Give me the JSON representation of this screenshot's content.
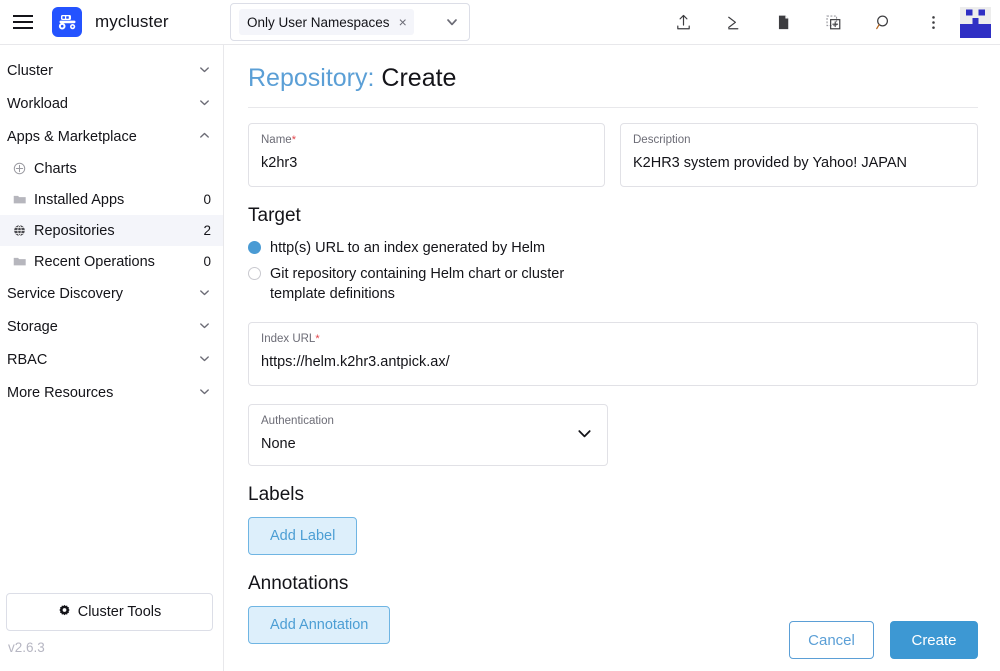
{
  "topbar": {
    "menu_icon": "hamburger-icon",
    "logo_icon": "rancher-logo-icon",
    "cluster_name": "mycluster",
    "namespace_filter": {
      "chip_label": "Only User Namespaces",
      "chip_remove": "×",
      "caret": "⌄"
    },
    "icons": [
      {
        "name": "import-yaml-icon",
        "glyph": "upload"
      },
      {
        "name": "kubectl-shell-icon",
        "glyph": "terminal"
      },
      {
        "name": "kubeconfig-download-icon",
        "glyph": "file"
      },
      {
        "name": "copy-kubeconfig-icon",
        "glyph": "copy"
      },
      {
        "name": "search-icon",
        "glyph": "search"
      },
      {
        "name": "overflow-menu-icon",
        "glyph": "kebab"
      }
    ],
    "avatar": "user-avatar"
  },
  "sidebar": {
    "groups": [
      {
        "label": "Cluster",
        "expanded": false
      },
      {
        "label": "Workload",
        "expanded": false
      },
      {
        "label": "Apps & Marketplace",
        "expanded": true
      }
    ],
    "items": [
      {
        "label": "Charts",
        "icon": "compass-icon",
        "count": "",
        "active": false
      },
      {
        "label": "Installed Apps",
        "icon": "folder-icon",
        "count": "0",
        "active": false
      },
      {
        "label": "Repositories",
        "icon": "globe-icon",
        "count": "2",
        "active": true
      },
      {
        "label": "Recent Operations",
        "icon": "folder-icon",
        "count": "0",
        "active": false
      }
    ],
    "groups_after": [
      {
        "label": "Service Discovery",
        "expanded": false
      },
      {
        "label": "Storage",
        "expanded": false
      },
      {
        "label": "RBAC",
        "expanded": false
      },
      {
        "label": "More Resources",
        "expanded": false
      }
    ],
    "cluster_tools": "Cluster Tools",
    "cluster_tools_icon": "gear-icon",
    "version": "v2.6.3"
  },
  "main": {
    "title_prefix": "Repository:",
    "title_current": "Create",
    "fields": {
      "name": {
        "label": "Name",
        "required": "*",
        "value": "k2hr3"
      },
      "description": {
        "label": "Description",
        "required": "",
        "value": "K2HR3 system provided by Yahoo! JAPAN"
      },
      "index_url": {
        "label": "Index URL",
        "required": "*",
        "value": "https://helm.k2hr3.antpick.ax/"
      },
      "authentication": {
        "label": "Authentication",
        "required": "",
        "value": "None"
      }
    },
    "target": {
      "heading": "Target",
      "options": [
        {
          "label": "http(s) URL to an index generated by Helm",
          "selected": true
        },
        {
          "label": "Git repository containing Helm chart or cluster template definitions",
          "selected": false
        }
      ]
    },
    "labels": {
      "heading": "Labels",
      "button": "Add Label"
    },
    "annotations": {
      "heading": "Annotations",
      "button": "Add Annotation"
    },
    "footer": {
      "cancel": "Cancel",
      "create": "Create"
    }
  },
  "colors": {
    "accent_blue": "#3d98d3",
    "link_blue": "#5b9fd6",
    "logo_blue": "#2453ff",
    "required_red": "#e2444a",
    "selected_row_bg": "#f4f5fa"
  }
}
